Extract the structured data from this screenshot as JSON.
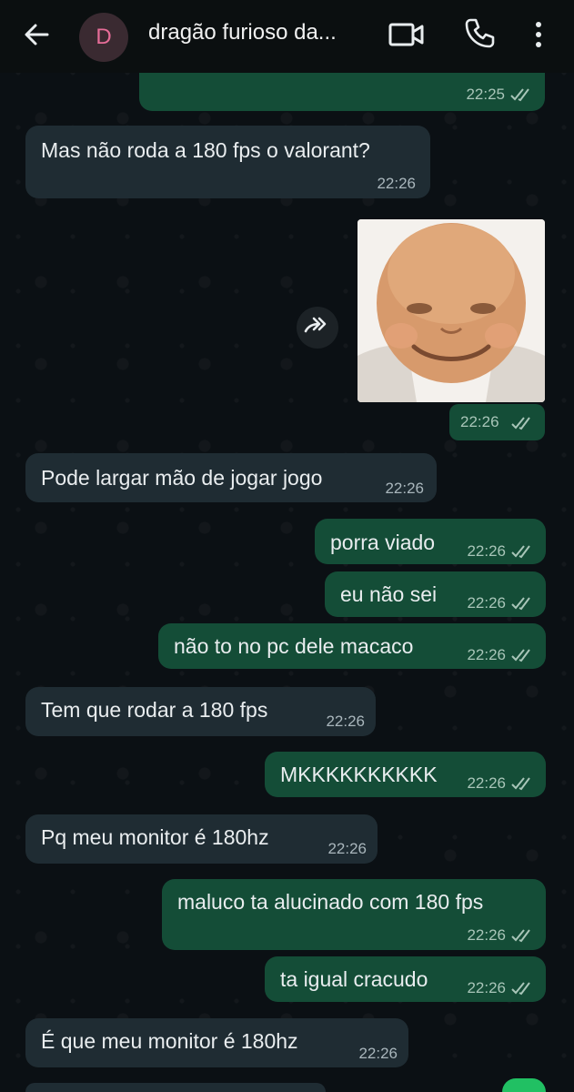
{
  "header": {
    "avatar_letter": "D",
    "contact_name": "dragão furioso da..."
  },
  "messages": [
    {
      "dir": "out",
      "text": "",
      "time": "22:25",
      "read": true
    },
    {
      "dir": "in",
      "text": "Mas não roda a 180 fps o valorant?",
      "time": "22:26"
    },
    {
      "dir": "out",
      "type": "sticker",
      "time": "22:26",
      "read": true
    },
    {
      "dir": "in",
      "text": "Pode largar mão de jogar jogo",
      "time": "22:26"
    },
    {
      "dir": "out",
      "text": "porra viado",
      "time": "22:26",
      "read": true
    },
    {
      "dir": "out",
      "text": "eu não sei",
      "time": "22:26",
      "read": true
    },
    {
      "dir": "out",
      "text": "não to no pc dele macaco",
      "time": "22:26",
      "read": true
    },
    {
      "dir": "in",
      "text": "Tem que rodar a 180 fps",
      "time": "22:26"
    },
    {
      "dir": "out",
      "text": "MKKKKKKKKKK",
      "time": "22:26",
      "read": true
    },
    {
      "dir": "in",
      "text": "Pq meu monitor é 180hz",
      "time": "22:26"
    },
    {
      "dir": "out",
      "text": "maluco ta alucinado com 180 fps",
      "time": "22:26",
      "read": true
    },
    {
      "dir": "out",
      "text": "ta igual cracudo",
      "time": "22:26",
      "read": true
    },
    {
      "dir": "in",
      "text": "É que meu monitor é 180hz",
      "time": "22:26"
    }
  ],
  "colors": {
    "outgoing_bubble": "#144d37",
    "incoming_bubble": "#1f2c33",
    "read_ticks": "#a8c5b8",
    "accent": "#21c063"
  },
  "icons": [
    "back-arrow-icon",
    "video-call-icon",
    "phone-icon",
    "more-options-icon",
    "forward-icon",
    "double-check-icon"
  ]
}
